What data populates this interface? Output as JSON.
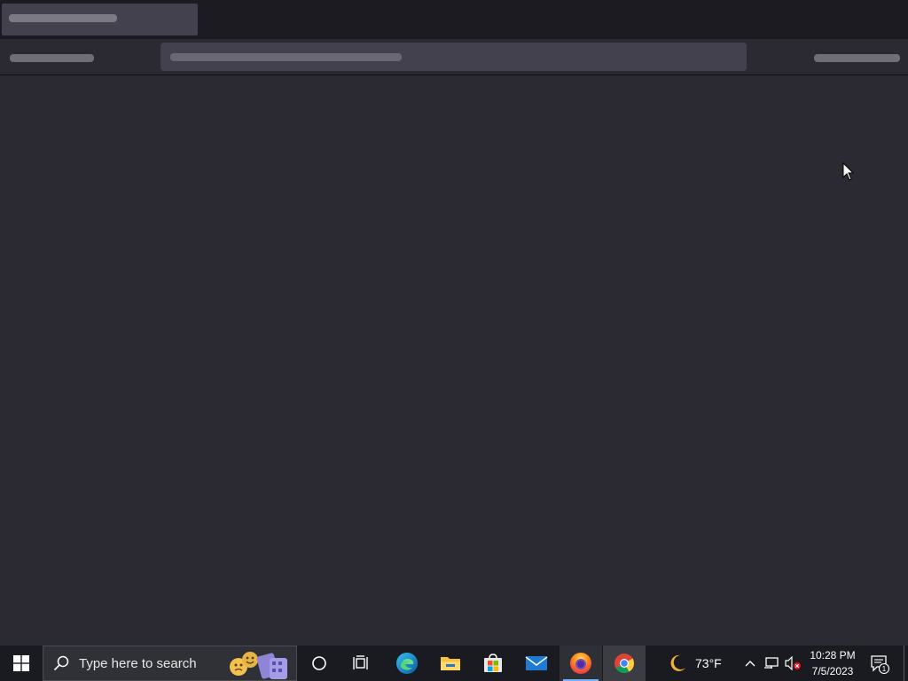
{
  "taskbar": {
    "search_placeholder": "Type here to search",
    "weather_temp": "73°F",
    "clock_time": "10:28 PM",
    "clock_date": "7/5/2023",
    "notification_count": "1",
    "apps": [
      "cortana",
      "task-view",
      "edge",
      "file-explorer",
      "microsoft-store",
      "mail",
      "firefox",
      "chrome"
    ],
    "active_app": "firefox"
  },
  "browser": {
    "state": "loading"
  },
  "colors": {
    "content_bg": "#2b2a33",
    "tabstrip_bg": "#1c1b22",
    "taskbar_bg": "#191b20",
    "accent": "#77b4ff"
  }
}
